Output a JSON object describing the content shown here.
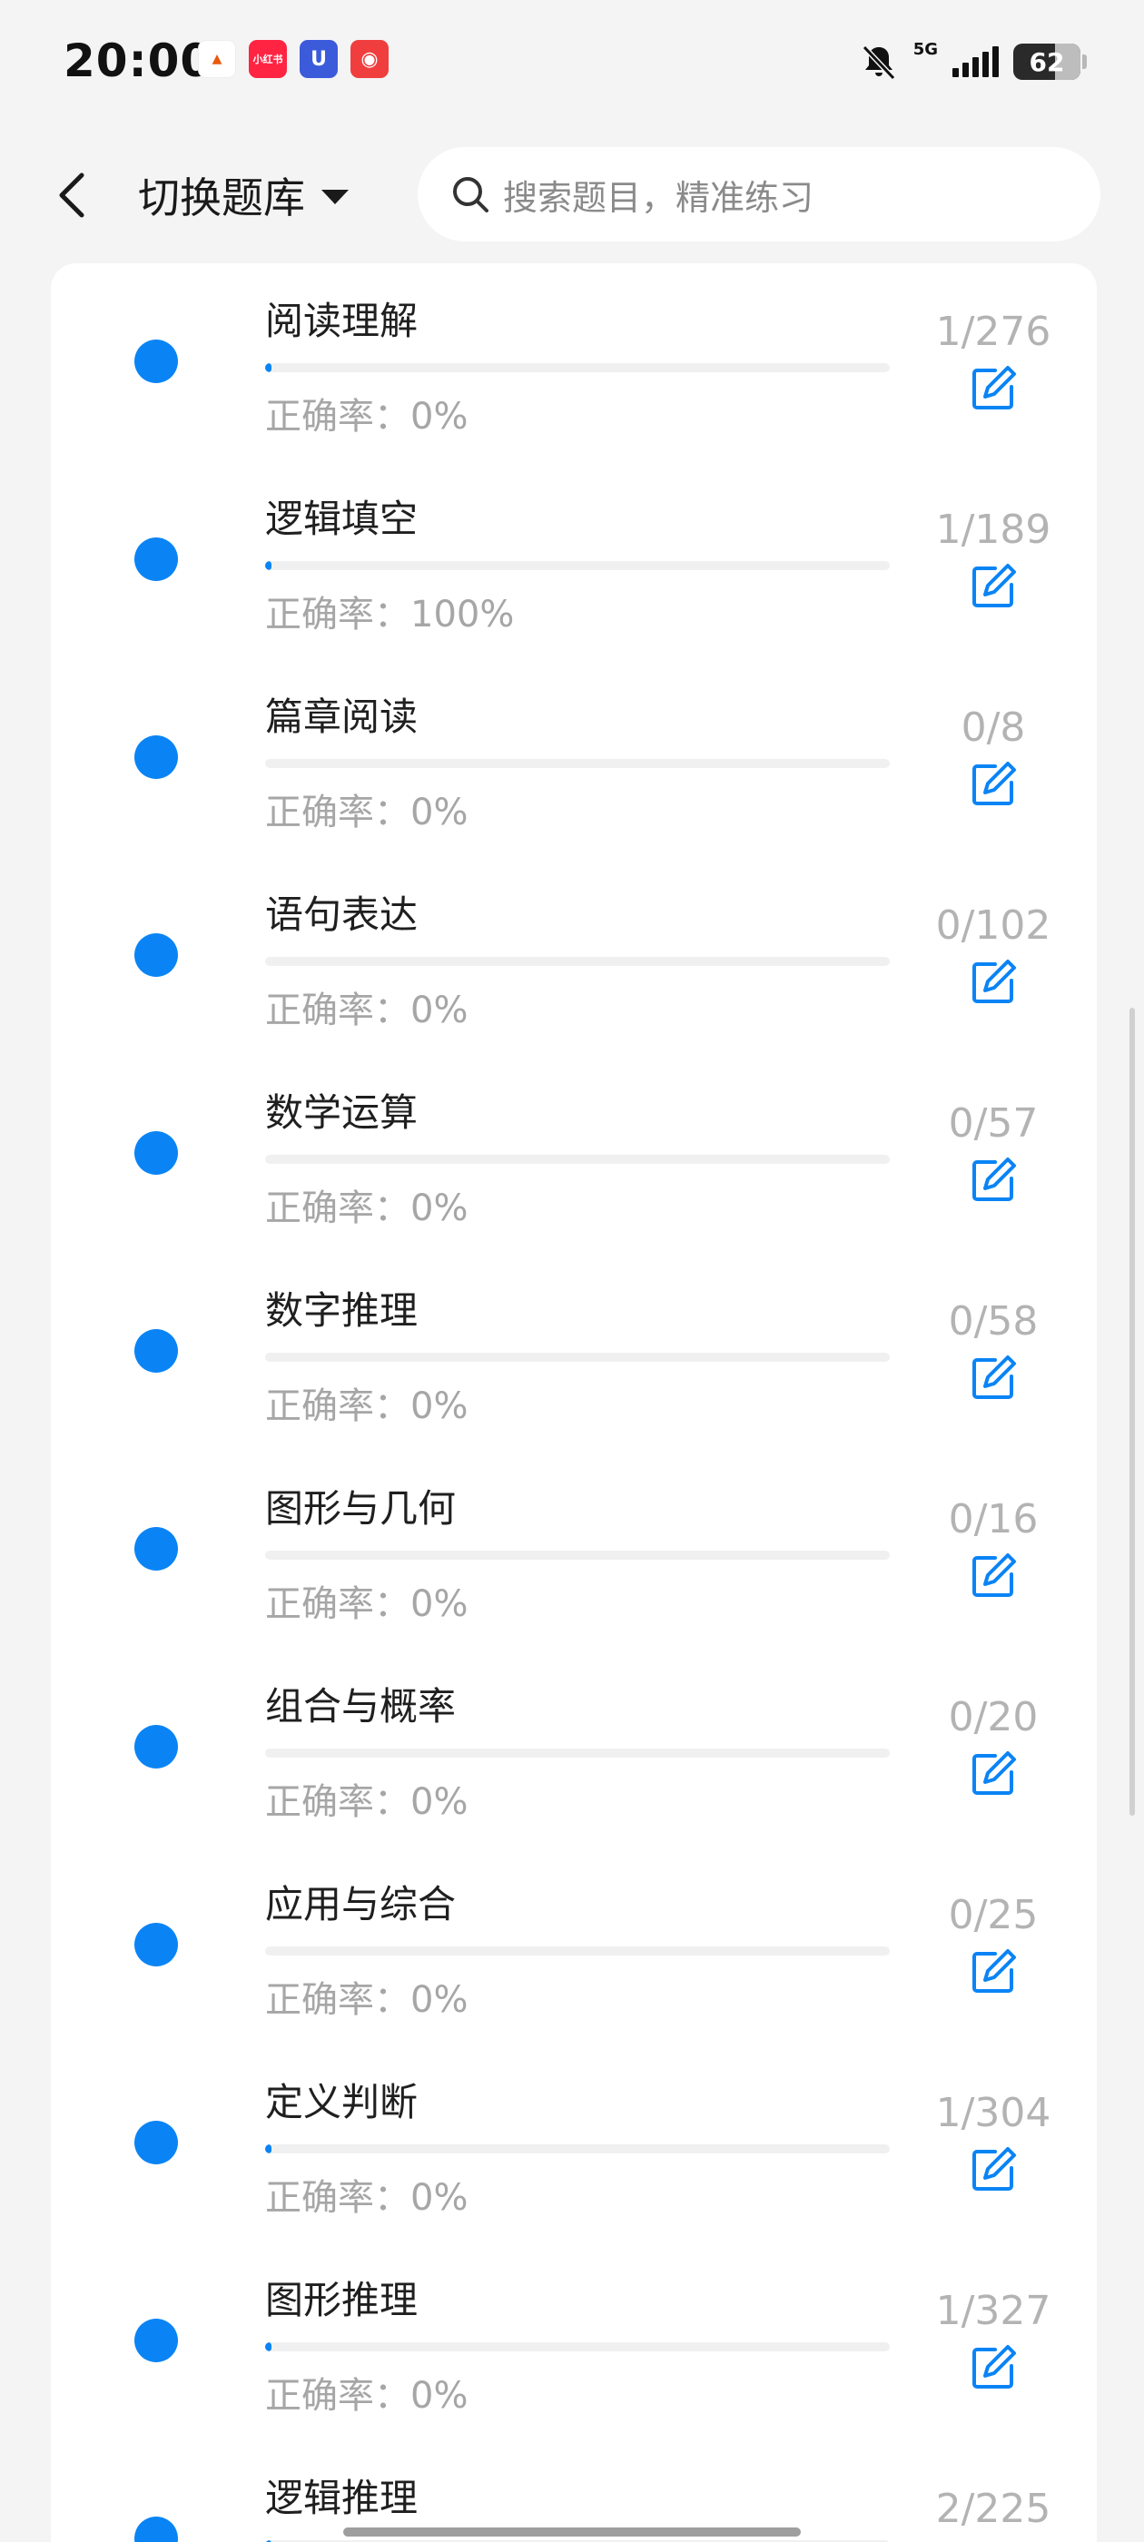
{
  "status_bar": {
    "time": "20:00",
    "network": "5G",
    "battery": "62",
    "app_icons": [
      {
        "name": "app-icon-1",
        "color": "#ffffff",
        "glyph": "▲"
      },
      {
        "name": "app-icon-xiaohongshu",
        "color": "#ff2442",
        "glyph": "小红书"
      },
      {
        "name": "app-icon-3",
        "color": "#3b5bdb",
        "glyph": "U"
      },
      {
        "name": "app-icon-4",
        "color": "#f03e3e",
        "glyph": "◉"
      }
    ]
  },
  "header": {
    "switch_label": "切换题库",
    "search_placeholder": "搜索题目，精准练习"
  },
  "colors": {
    "accent": "#0a84f5",
    "muted": "#a6a6a6"
  },
  "accuracy_prefix": "正确率：",
  "items": [
    {
      "title": "阅读理解",
      "accuracy": "0%",
      "count": "1/276",
      "progress": 0.0036
    },
    {
      "title": "逻辑填空",
      "accuracy": "100%",
      "count": "1/189",
      "progress": 0.0053
    },
    {
      "title": "篇章阅读",
      "accuracy": "0%",
      "count": "0/8",
      "progress": 0
    },
    {
      "title": "语句表达",
      "accuracy": "0%",
      "count": "0/102",
      "progress": 0
    },
    {
      "title": "数学运算",
      "accuracy": "0%",
      "count": "0/57",
      "progress": 0
    },
    {
      "title": "数字推理",
      "accuracy": "0%",
      "count": "0/58",
      "progress": 0
    },
    {
      "title": "图形与几何",
      "accuracy": "0%",
      "count": "0/16",
      "progress": 0
    },
    {
      "title": "组合与概率",
      "accuracy": "0%",
      "count": "0/20",
      "progress": 0
    },
    {
      "title": "应用与综合",
      "accuracy": "0%",
      "count": "0/25",
      "progress": 0
    },
    {
      "title": "定义判断",
      "accuracy": "0%",
      "count": "1/304",
      "progress": 0.0033
    },
    {
      "title": "图形推理",
      "accuracy": "0%",
      "count": "1/327",
      "progress": 0.0031
    },
    {
      "title": "逻辑推理",
      "accuracy": "",
      "count": "2/225",
      "progress": 0.0089
    }
  ]
}
